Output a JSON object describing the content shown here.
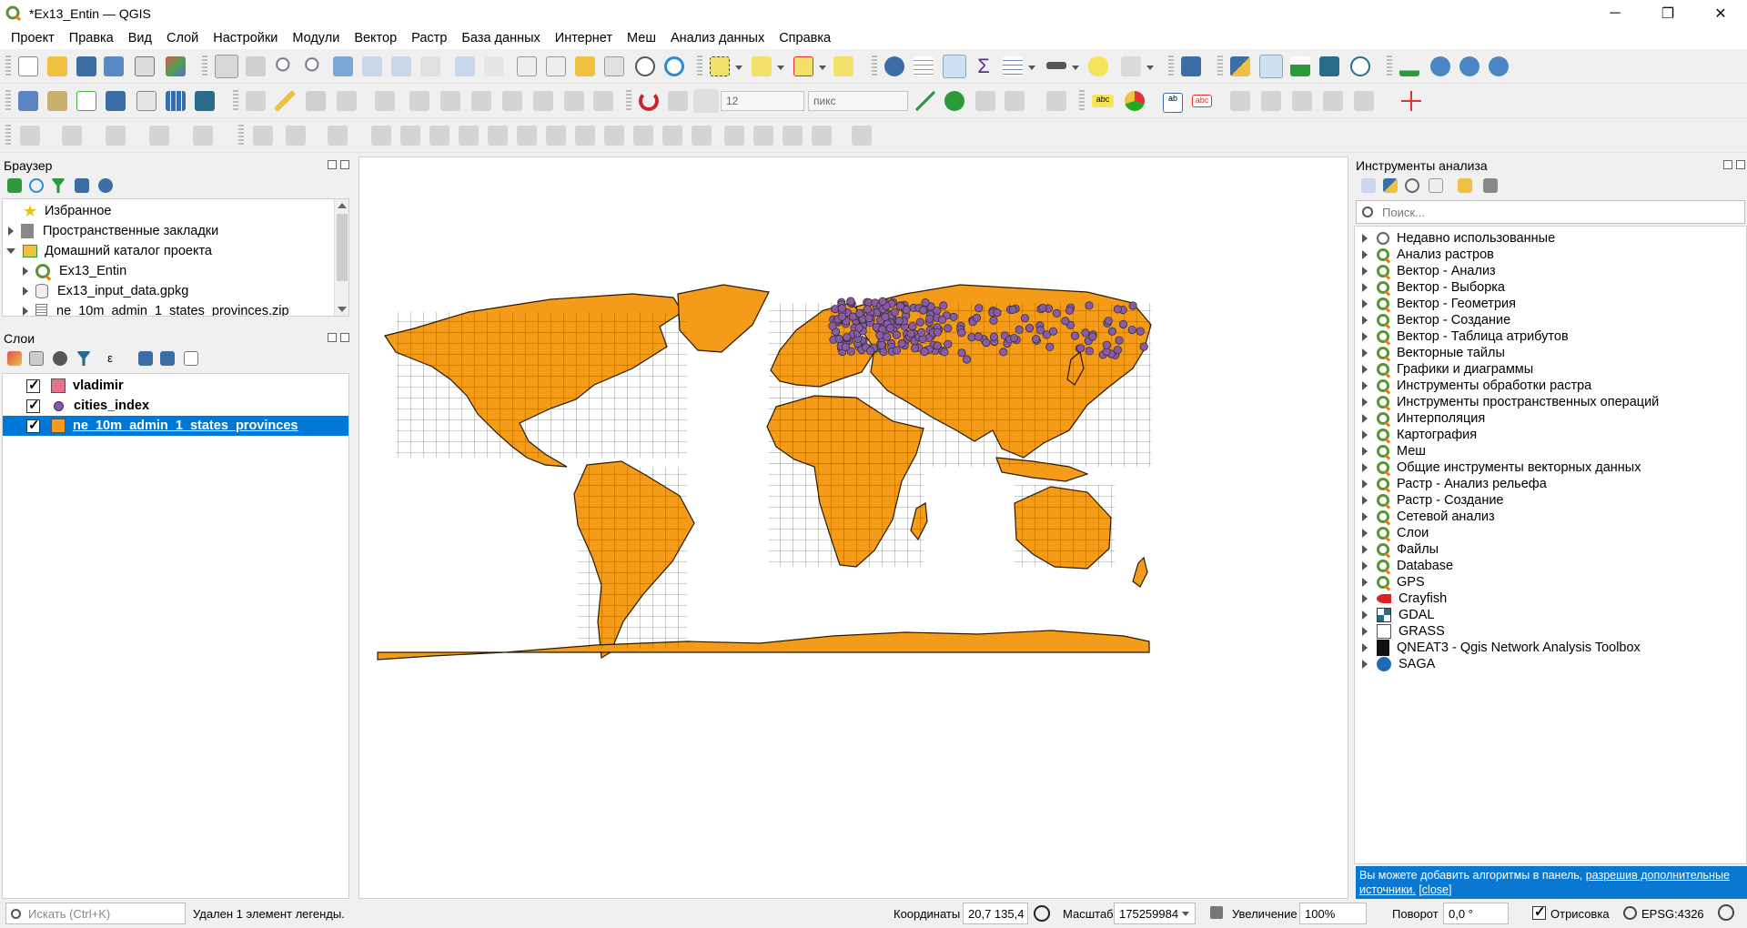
{
  "window": {
    "title": "*Ex13_Entin — QGIS",
    "controls": [
      "─",
      "❐",
      "✕"
    ]
  },
  "menubar": [
    "Проект",
    "Правка",
    "Вид",
    "Слой",
    "Настройки",
    "Модули",
    "Вектор",
    "Растр",
    "База данных",
    "Интернет",
    "Меш",
    "Анализ данных",
    "Справка"
  ],
  "toolbar": {
    "snap_tolerance": "12",
    "snap_units": "пикс"
  },
  "browser": {
    "title": "Браузер",
    "items": [
      {
        "label": "Избранное",
        "icon": "star-icon",
        "indent": 0,
        "expander": "none"
      },
      {
        "label": "Пространственные закладки",
        "icon": "bookmark-icon",
        "indent": 0,
        "expander": "closed"
      },
      {
        "label": "Домашний каталог проекта",
        "icon": "home-folder-icon",
        "indent": 0,
        "expander": "open"
      },
      {
        "label": "Ex13_Entin",
        "icon": "qgis-project-icon",
        "indent": 1,
        "expander": "closed"
      },
      {
        "label": "Ex13_input_data.gpkg",
        "icon": "geopackage-icon",
        "indent": 1,
        "expander": "closed"
      },
      {
        "label": "ne_10m_admin_1_states_provinces.zip",
        "icon": "zip-icon",
        "indent": 1,
        "expander": "closed"
      }
    ]
  },
  "layers": {
    "title": "Слои",
    "items": [
      {
        "label": "vladimir",
        "checked": true,
        "symbol": "square",
        "color": "#e8708a",
        "selected": false
      },
      {
        "label": "cities_index",
        "checked": true,
        "symbol": "circle",
        "color": "#8a5aa6",
        "selected": false
      },
      {
        "label": "ne_10m_admin_1_states_provinces",
        "checked": true,
        "symbol": "square",
        "color": "#f49b1a",
        "selected": true
      }
    ]
  },
  "processing": {
    "title": "Инструменты анализа",
    "search_placeholder": "Поиск...",
    "items": [
      {
        "label": "Недавно использованные",
        "icon": "clock-icon"
      },
      {
        "label": "Анализ растров",
        "icon": "qgis-icon"
      },
      {
        "label": "Вектор - Анализ",
        "icon": "qgis-icon"
      },
      {
        "label": "Вектор - Выборка",
        "icon": "qgis-icon"
      },
      {
        "label": "Вектор - Геометрия",
        "icon": "qgis-icon"
      },
      {
        "label": "Вектор - Создание",
        "icon": "qgis-icon"
      },
      {
        "label": "Вектор - Таблица атрибутов",
        "icon": "qgis-icon"
      },
      {
        "label": "Векторные тайлы",
        "icon": "qgis-icon"
      },
      {
        "label": "Графики и диаграммы",
        "icon": "qgis-icon"
      },
      {
        "label": "Инструменты обработки растра",
        "icon": "qgis-icon"
      },
      {
        "label": "Инструменты пространственных операций",
        "icon": "qgis-icon"
      },
      {
        "label": "Интерполяция",
        "icon": "qgis-icon"
      },
      {
        "label": "Картография",
        "icon": "qgis-icon"
      },
      {
        "label": "Меш",
        "icon": "qgis-icon"
      },
      {
        "label": "Общие инструменты векторных данных",
        "icon": "qgis-icon"
      },
      {
        "label": "Растр - Анализ рельефа",
        "icon": "qgis-icon"
      },
      {
        "label": "Растр - Создание",
        "icon": "qgis-icon"
      },
      {
        "label": "Сетевой анализ",
        "icon": "qgis-icon"
      },
      {
        "label": "Слои",
        "icon": "qgis-icon"
      },
      {
        "label": "Файлы",
        "icon": "qgis-icon"
      },
      {
        "label": "Database",
        "icon": "qgis-icon"
      },
      {
        "label": "GPS",
        "icon": "qgis-icon"
      },
      {
        "label": "Crayfish",
        "icon": "crayfish-icon"
      },
      {
        "label": "GDAL",
        "icon": "gdal-icon"
      },
      {
        "label": "GRASS",
        "icon": "grass-icon"
      },
      {
        "label": "QNEAT3 - Qgis Network Analysis Toolbox",
        "icon": "qneat-icon"
      },
      {
        "label": "SAGA",
        "icon": "saga-icon"
      }
    ],
    "notice_text": "Вы можете добавить алгоритмы в панель, ",
    "notice_link": "разрешив дополнительные источники.",
    "notice_close": "[close]"
  },
  "status": {
    "search_placeholder": "Искать (Ctrl+K)",
    "message": "Удален 1 элемент легенды.",
    "coord_label": "Координаты",
    "coord_value": "20,7 135,4",
    "scale_label": "Масштаб",
    "scale_value": "175259984",
    "zoom_label": "Увеличение",
    "zoom_value": "100%",
    "rotation_label": "Поворот",
    "rotation_value": "0,0 °",
    "render_label": "Отрисовка",
    "crs": "EPSG:4326"
  },
  "colors": {
    "land": "#f49b1a",
    "cities": "#8a5aa6",
    "selection": "#0078d7",
    "qgis_green": "#589632"
  }
}
